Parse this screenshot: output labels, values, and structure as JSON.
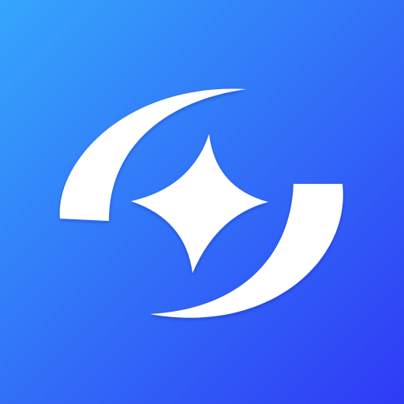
{
  "app_icon": {
    "icon": "sparkle-orbit-icon",
    "background_gradient": [
      "#35A6FC",
      "#2F3AF5"
    ],
    "symbol_color": "#FFFFFF"
  }
}
